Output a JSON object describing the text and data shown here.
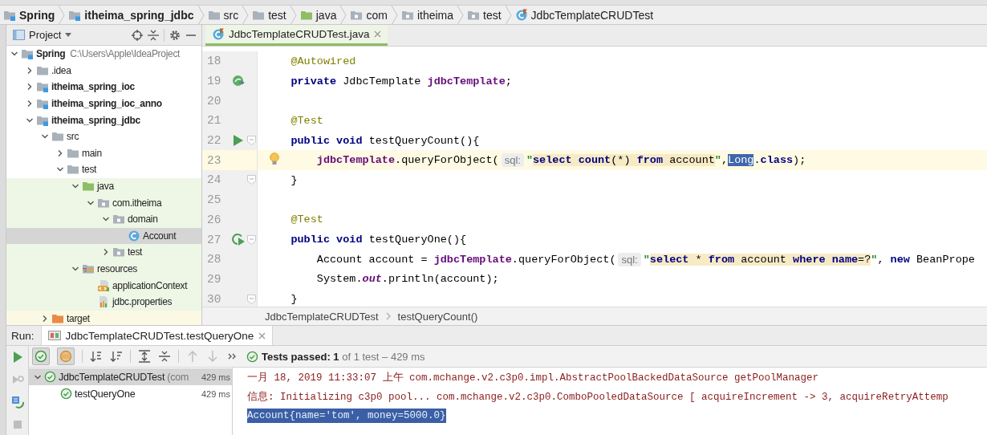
{
  "nav_bar": {
    "items": [
      {
        "label": "Spring",
        "kind": "module"
      },
      {
        "label": "itheima_spring_jdbc",
        "kind": "module"
      },
      {
        "label": "src",
        "kind": "folder"
      },
      {
        "label": "test",
        "kind": "folder"
      },
      {
        "label": "java",
        "kind": "sourcefolder"
      },
      {
        "label": "com",
        "kind": "package"
      },
      {
        "label": "itheima",
        "kind": "package"
      },
      {
        "label": "test",
        "kind": "package"
      },
      {
        "label": "JdbcTemplateCRUDTest",
        "kind": "testclass"
      }
    ]
  },
  "project_panel": {
    "title": "Project",
    "tree": [
      {
        "label": "Spring",
        "path": "C:\\Users\\Apple\\IdeaProject",
        "kind": "module",
        "expanded": true,
        "selected": false,
        "children": [
          {
            "label": ".idea",
            "kind": "folder",
            "expanded": false,
            "selected": false
          },
          {
            "label": "itheima_spring_ioc",
            "kind": "module",
            "expanded": false,
            "selected": false
          },
          {
            "label": "itheima_spring_ioc_anno",
            "kind": "module",
            "expanded": false,
            "selected": false
          },
          {
            "label": "itheima_spring_jdbc",
            "kind": "module",
            "expanded": true,
            "selected": false,
            "children": [
              {
                "label": "src",
                "kind": "folder",
                "expanded": true,
                "selected": false,
                "children": [
                  {
                    "label": "main",
                    "kind": "folder",
                    "expanded": false,
                    "selected": false
                  },
                  {
                    "label": "test",
                    "kind": "folder",
                    "expanded": true,
                    "selected": false,
                    "children": [
                      {
                        "label": "java",
                        "kind": "sourcefolder",
                        "test_source": true,
                        "expanded": true,
                        "selected": false,
                        "children": [
                          {
                            "label": "com.itheima",
                            "kind": "package",
                            "test_source": true,
                            "expanded": true,
                            "selected": false,
                            "children": [
                              {
                                "label": "domain",
                                "kind": "package",
                                "test_source": true,
                                "expanded": true,
                                "selected": false,
                                "children": [
                                  {
                                    "label": "Account",
                                    "kind": "class",
                                    "selected": true
                                  }
                                ]
                              },
                              {
                                "label": "test",
                                "kind": "package",
                                "test_source": true,
                                "expanded": false,
                                "selected": false
                              }
                            ]
                          }
                        ]
                      },
                      {
                        "label": "resources",
                        "kind": "resources",
                        "test_source": true,
                        "expanded": true,
                        "selected": false,
                        "children": [
                          {
                            "label": "applicationContext",
                            "kind": "xml",
                            "test_source": true,
                            "selected": false
                          },
                          {
                            "label": "jdbc.properties",
                            "kind": "properties",
                            "test_source": true,
                            "selected": false
                          }
                        ]
                      }
                    ]
                  }
                ]
              },
              {
                "label": "target",
                "kind": "excluded",
                "excluded": true,
                "expanded": false,
                "selected": false
              }
            ]
          }
        ]
      }
    ]
  },
  "editor": {
    "tabs": [
      {
        "label": "JdbcTemplateCRUDTest.java",
        "kind": "testclass",
        "selected": true
      }
    ],
    "lines": [
      {
        "number": "18",
        "current": false,
        "tokens": [
          {
            "kind": "annotation",
            "text": "    @Autowired"
          }
        ]
      },
      {
        "number": "19",
        "current": false,
        "marker": {
          "kind": "bean"
        },
        "tokens": [
          {
            "kind": "keyword",
            "text": "    private"
          },
          {
            "kind": "plain",
            "text": " JdbcTemplate "
          },
          {
            "kind": "field",
            "text": "jdbcTemplate"
          },
          {
            "kind": "plain",
            "text": ";"
          }
        ]
      },
      {
        "number": "20",
        "current": false
      },
      {
        "number": "21",
        "current": false,
        "tokens": [
          {
            "kind": "annotation",
            "text": "    @Test"
          }
        ]
      },
      {
        "number": "22",
        "current": false,
        "marker": {
          "kind": "run"
        },
        "fold": true,
        "tokens": [
          {
            "kind": "keyword",
            "text": "    public void"
          },
          {
            "kind": "plain",
            "text": " testQueryCount(){"
          }
        ]
      },
      {
        "number": "23",
        "current": true,
        "marker": {
          "kind": "bulb"
        },
        "tokens": [
          {
            "kind": "field",
            "text": "        jdbcTemplate"
          },
          {
            "kind": "plain",
            "text": ".queryForObject("
          },
          {
            "kind": "hint",
            "text": "sql:"
          },
          {
            "kind": "quote",
            "text": "\""
          },
          {
            "kind": "sqlkw",
            "text": "select count"
          },
          {
            "kind": "sqltext",
            "text": "(*) "
          },
          {
            "kind": "sqlkw",
            "text": "from"
          },
          {
            "kind": "sqltext",
            "text": " account"
          },
          {
            "kind": "quote",
            "text": "\""
          },
          {
            "kind": "plain",
            "text": ","
          },
          {
            "kind": "selection",
            "text": "Long"
          },
          {
            "kind": "plain",
            "text": "."
          },
          {
            "kind": "keyword",
            "text": "class"
          },
          {
            "kind": "plain",
            "text": ");"
          }
        ]
      },
      {
        "number": "24",
        "current": false,
        "fold": true,
        "tokens": [
          {
            "kind": "plain",
            "text": "    }"
          }
        ]
      },
      {
        "number": "25",
        "current": false
      },
      {
        "number": "26",
        "current": false,
        "tokens": [
          {
            "kind": "annotation",
            "text": "    @Test"
          }
        ]
      },
      {
        "number": "27",
        "current": false,
        "marker": {
          "kind": "rerun"
        },
        "fold": true,
        "tokens": [
          {
            "kind": "keyword",
            "text": "    public void"
          },
          {
            "kind": "plain",
            "text": " testQueryOne(){"
          }
        ]
      },
      {
        "number": "28",
        "current": false,
        "tokens": [
          {
            "kind": "plain",
            "text": "        Account account = "
          },
          {
            "kind": "field",
            "text": "jdbcTemplate"
          },
          {
            "kind": "plain",
            "text": ".queryForObject("
          },
          {
            "kind": "hint",
            "text": "sql:"
          },
          {
            "kind": "quote",
            "text": "\""
          },
          {
            "kind": "sqlkw",
            "text": "select"
          },
          {
            "kind": "sqltext",
            "text": " * "
          },
          {
            "kind": "sqlkw",
            "text": "from"
          },
          {
            "kind": "sqltext",
            "text": " account "
          },
          {
            "kind": "sqlkw",
            "text": "where name"
          },
          {
            "kind": "sqltext",
            "text": "=?"
          },
          {
            "kind": "quote",
            "text": "\""
          },
          {
            "kind": "plain",
            "text": ", "
          },
          {
            "kind": "keyword",
            "text": "new"
          },
          {
            "kind": "plain",
            "text": " BeanPrope"
          }
        ]
      },
      {
        "number": "29",
        "current": false,
        "tokens": [
          {
            "kind": "plain",
            "text": "        System."
          },
          {
            "kind": "static",
            "text": "out"
          },
          {
            "kind": "plain",
            "text": ".println(account);"
          }
        ]
      },
      {
        "number": "30",
        "current": false,
        "fold": true,
        "tokens": [
          {
            "kind": "plain",
            "text": "    }"
          }
        ]
      }
    ],
    "breadcrumb": [
      "JdbcTemplateCRUDTest",
      "testQueryCount()"
    ]
  },
  "run_panel": {
    "label": "Run:",
    "tabs": [
      {
        "label": "JdbcTemplateCRUDTest.testQueryOne",
        "selected": true
      }
    ],
    "toggles": [
      {
        "kind": "passed",
        "on": true
      },
      {
        "kind": "ignored",
        "on": true
      }
    ],
    "status": "**Tests passed: 1** of 1 test – 429 ms",
    "tests": [
      {
        "label": "JdbcTemplateCRUDTest",
        "detail": "(com",
        "time": "429 ms",
        "passed": true,
        "expanded": true,
        "selected": true,
        "children": [
          {
            "label": "testQueryOne",
            "time": "429 ms",
            "passed": true,
            "selected": false
          }
        ]
      }
    ],
    "console": [
      {
        "text": "一月 18, 2019 11:33:07 上午 com.mchange.v2.c3p0.impl.AbstractPoolBackedDataSource getPoolManager",
        "selected": false
      },
      {
        "text": "信息: Initializing c3p0 pool... com.mchange.v2.c3p0.ComboPooledDataSource [ acquireIncrement -> 3, acquireRetryAttemp",
        "selected": false
      },
      {
        "text": "Account{name='tom', money=5000.0}",
        "selected": true
      }
    ]
  }
}
